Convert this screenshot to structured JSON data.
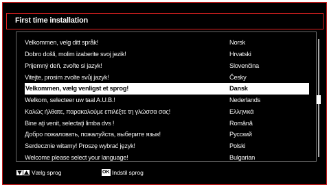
{
  "title": "First time installation",
  "languages": [
    {
      "greeting": "Velkommen, velg ditt språk!",
      "language": "Norsk"
    },
    {
      "greeting": "Dobro došli, molim izaberite svoj jezik!",
      "language": "Hrvatski"
    },
    {
      "greeting": "Prijemný deň, zvoľte si jazyk!",
      "language": "Slovenčina"
    },
    {
      "greeting": "Vitejte, prosim zvolte svůj jazyk!",
      "language": "Česky"
    },
    {
      "greeting": "Velkommen, vælg venligst et sprog!",
      "language": "Dansk",
      "selected": true
    },
    {
      "greeting": "Welkom, selecteer uw taal A.U.B.!",
      "language": "Nederlands"
    },
    {
      "greeting": "Καλώς ήλθατε, παρακαλούμε επιλέξτε τη γλώσσα σας!",
      "language": "Ελληνικά"
    },
    {
      "greeting": "Bine aţi venit, selectaţi limba dvs !",
      "language": "Română"
    },
    {
      "greeting": "Добро пожаловать, пожалуйста, выберите язык!",
      "language": "Русский"
    },
    {
      "greeting": "Serdecznie witamy! Proszę wybrać język!",
      "language": "Polski"
    },
    {
      "greeting": "Welcome please select your language!",
      "language": "Bulgarian"
    }
  ],
  "footer": {
    "nav_label": "Vælg sprog",
    "ok_key": "OK",
    "ok_label": "Indstil sprog",
    "icons": [
      "arrow-down-icon",
      "arrow-up-icon"
    ]
  },
  "colors": {
    "frame_border": "#cc1c1c",
    "background": "#000000",
    "selection": "#ffffff",
    "text": "#f2f2f2"
  },
  "scrollbar": {
    "position_fraction": 0.5
  }
}
